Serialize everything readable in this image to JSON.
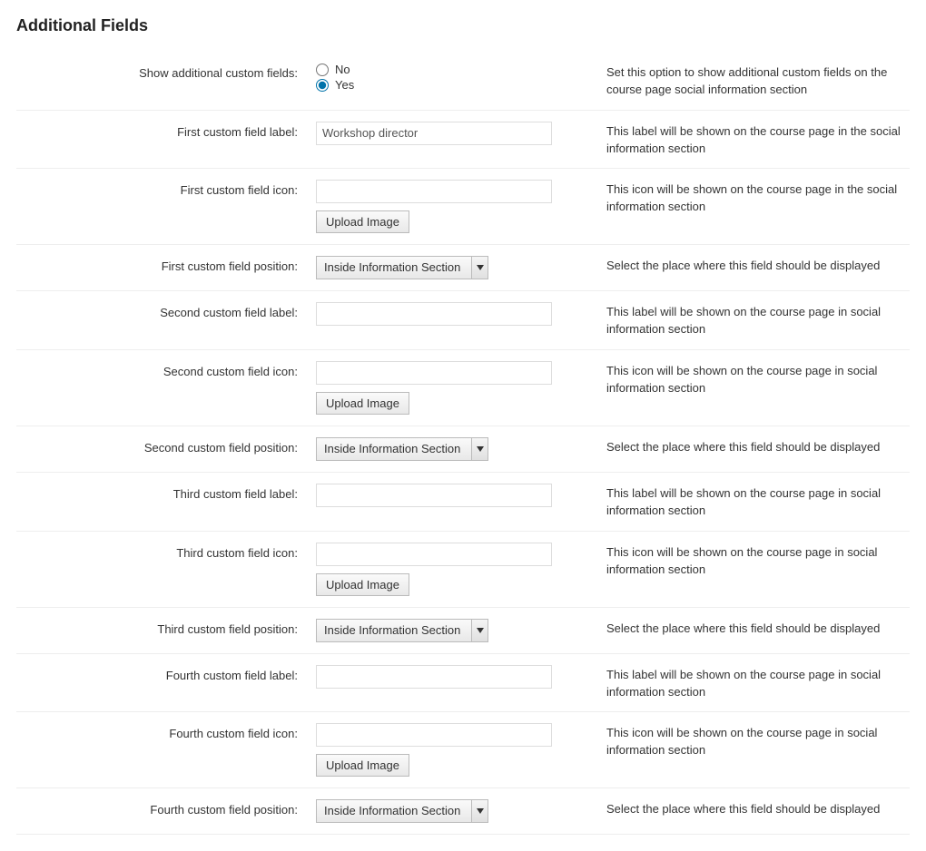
{
  "heading": "Additional Fields",
  "labels": {
    "show_custom": "Show additional custom fields:",
    "first_label": "First custom field label:",
    "first_icon": "First custom field icon:",
    "first_position": "First custom field position:",
    "second_label": "Second custom field label:",
    "second_icon": "Second custom field icon:",
    "second_position": "Second custom field position:",
    "third_label": "Third custom field label:",
    "third_icon": "Third custom field icon:",
    "third_position": "Third custom field position:",
    "fourth_label": "Fourth custom field label:",
    "fourth_icon": "Fourth custom field icon:",
    "fourth_position": "Fourth custom field position:"
  },
  "values": {
    "first_label_value": "Workshop director",
    "first_icon_value": "",
    "second_label_value": "",
    "second_icon_value": "",
    "third_label_value": "",
    "third_icon_value": "",
    "fourth_label_value": "",
    "fourth_icon_value": ""
  },
  "radio": {
    "no": "No",
    "yes": "Yes"
  },
  "upload_button": "Upload Image",
  "select_value": "Inside Information Section",
  "descriptions": {
    "show_custom": "Set this option to show additional custom fields on the course page social information section",
    "label_first": "This label will be shown on the course page in the social information section",
    "icon_first": "This icon will be shown on the course page in the social information section",
    "label_other": "This label will be shown on the course page in social information section",
    "icon_other": "This icon will be shown on the course page in social information section",
    "position": "Select the place where this field should be displayed"
  }
}
